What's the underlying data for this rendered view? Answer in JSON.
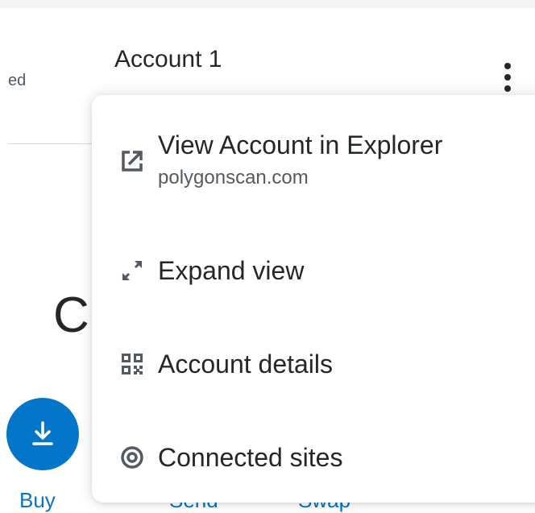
{
  "background": {
    "connected_status_fragment": "ed",
    "account_name": "Account 1",
    "balance_fragment": "C",
    "actions": [
      {
        "label": "Buy"
      },
      {
        "label": "Send"
      },
      {
        "label": "Swap"
      }
    ]
  },
  "menu": {
    "items": [
      {
        "label": "View Account in Explorer",
        "sublabel": "polygonscan.com",
        "icon": "external-link-icon"
      },
      {
        "label": "Expand view",
        "icon": "expand-icon"
      },
      {
        "label": "Account details",
        "icon": "qr-code-icon"
      },
      {
        "label": "Connected sites",
        "icon": "connected-sites-icon"
      }
    ]
  },
  "colors": {
    "accent": "#0376c9",
    "text": "#24272a",
    "muted": "#535a61",
    "icon": "#535a61"
  }
}
